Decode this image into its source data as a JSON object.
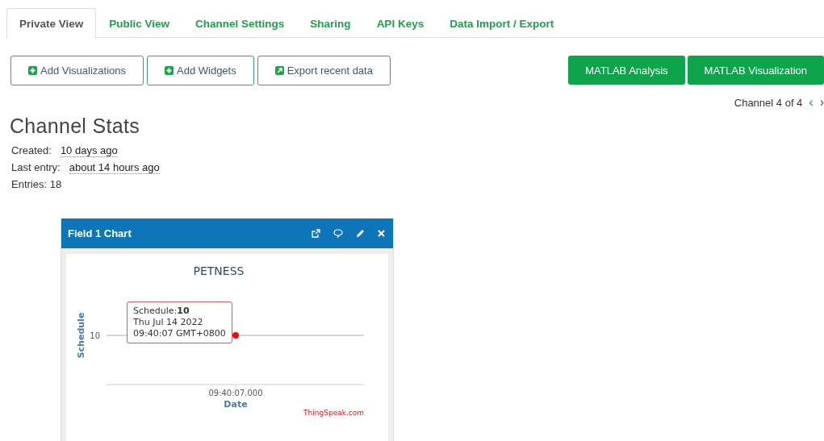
{
  "tabs": [
    {
      "label": "Private View",
      "selected": true
    },
    {
      "label": "Public View",
      "selected": false
    },
    {
      "label": "Channel Settings",
      "selected": false
    },
    {
      "label": "Sharing",
      "selected": false
    },
    {
      "label": "API Keys",
      "selected": false
    },
    {
      "label": "Data Import / Export",
      "selected": false
    }
  ],
  "toolbar": {
    "buttons": [
      {
        "label": "Add Visualizations",
        "kind": "add"
      },
      {
        "label": "Add Widgets",
        "kind": "add"
      },
      {
        "label": "Export recent data",
        "kind": "export"
      }
    ],
    "matlab_buttons": [
      "MATLAB Analysis",
      "MATLAB Visualization"
    ]
  },
  "channel_nav": {
    "label": "Channel 4 of 4",
    "prev": "‹",
    "next": "›"
  },
  "stats": {
    "title": "Channel Stats",
    "rows": [
      {
        "label": "Created:",
        "value": "10 days ago"
      },
      {
        "label": "Last entry:",
        "value": "about 14 hours ago"
      },
      {
        "label": "Entries: 18"
      }
    ]
  },
  "chart_card": {
    "title": "Field 1 Chart",
    "chart": {
      "title": "PETNESS",
      "x_axis_title": "Date",
      "y_axis_title": "Schedule",
      "x_tick": "09:40:07.000",
      "y_tick": "10"
    },
    "tooltip": [
      "Schedule:**10**",
      "Thu Jul 14 2022",
      "09:40:07 GMT+0800"
    ],
    "credit": "ThingSpeak.com"
  }
}
